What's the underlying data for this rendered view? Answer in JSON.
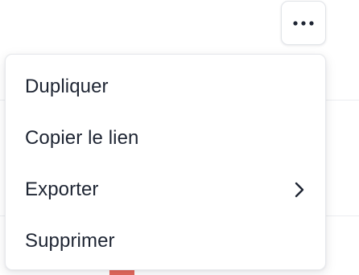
{
  "more_button": {
    "icon": "more-horizontal-icon"
  },
  "menu": {
    "items": [
      {
        "label": "Dupliquer"
      },
      {
        "label": "Copier le lien"
      },
      {
        "label": "Exporter",
        "icon": "chevron-right-icon"
      },
      {
        "label": "Supprimer"
      }
    ]
  },
  "colors": {
    "text": "#1e2533",
    "border": "#e6e8ec",
    "accent": "#e4675b"
  }
}
